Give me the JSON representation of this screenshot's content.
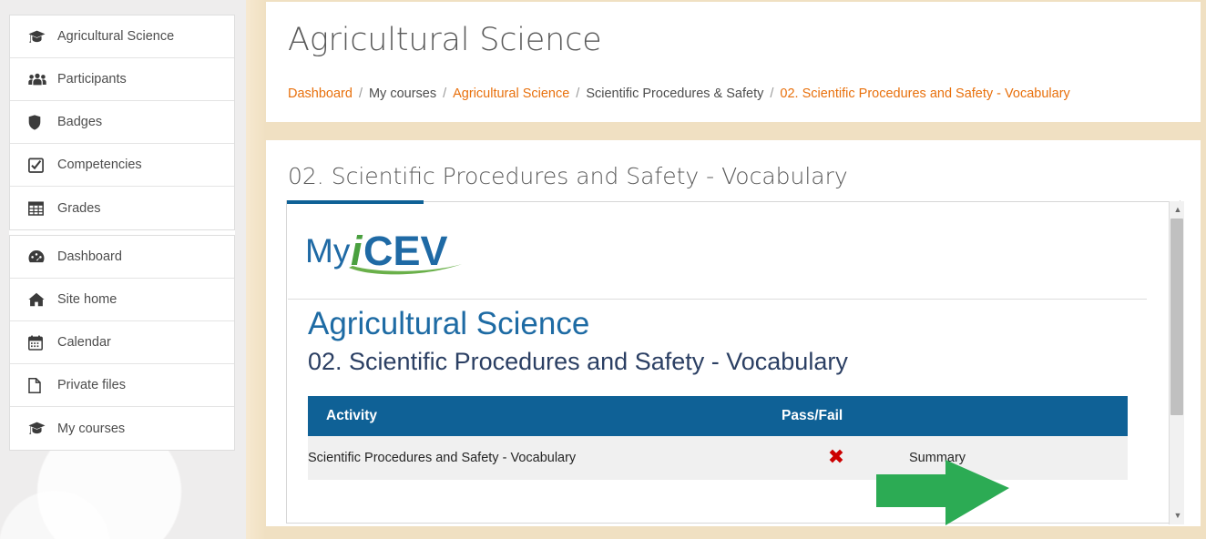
{
  "background": {
    "paper_color": "#f0e0c2",
    "accent_blue": "#0f6196",
    "breadcrumb_link": "#e8700c",
    "arrow_green": "#2cab54",
    "fail_red": "#cc0000"
  },
  "sidebar": {
    "groups": [
      {
        "items": [
          {
            "label": "Agricultural Science",
            "icon": "graduation-cap-icon"
          },
          {
            "label": "Participants",
            "icon": "users-icon"
          },
          {
            "label": "Badges",
            "icon": "shield-icon"
          },
          {
            "label": "Competencies",
            "icon": "check-square-icon"
          },
          {
            "label": "Grades",
            "icon": "table-icon"
          }
        ]
      },
      {
        "items": [
          {
            "label": "Dashboard",
            "icon": "tachometer-icon"
          },
          {
            "label": "Site home",
            "icon": "home-icon"
          },
          {
            "label": "Calendar",
            "icon": "calendar-icon"
          },
          {
            "label": "Private files",
            "icon": "file-icon"
          },
          {
            "label": "My courses",
            "icon": "graduation-cap-icon"
          }
        ]
      }
    ]
  },
  "header": {
    "title": "Agricultural Science",
    "breadcrumb": [
      {
        "label": "Dashboard",
        "link": true
      },
      {
        "label": "My courses",
        "link": false
      },
      {
        "label": "Agricultural Science",
        "link": true
      },
      {
        "label": "Scientific Procedures & Safety",
        "link": false
      },
      {
        "label": "02. Scientific Procedures and Safety - Vocabulary",
        "link": true
      }
    ],
    "separator": "/"
  },
  "main": {
    "activity_title": "02. Scientific Procedures and Safety - Vocabulary",
    "iframe": {
      "logo": {
        "my": "My",
        "i": "i",
        "cev": "CEV"
      },
      "heading": "Agricultural Science",
      "subheading": "02. Scientific Procedures and Safety - Vocabulary",
      "table": {
        "columns": [
          "Activity",
          "Pass/Fail"
        ],
        "rows": [
          {
            "activity": "Scientific Procedures and Safety - Vocabulary",
            "pass_fail": "✖",
            "pass_fail_state": "fail",
            "summary": "Summary"
          }
        ]
      }
    }
  },
  "annotation": {
    "type": "arrow",
    "direction": "right",
    "points_at": "Summary",
    "color": "#2cab54"
  },
  "scrollbar": {
    "up_arrow": "▲",
    "down_arrow": "▼",
    "orientation": "vertical"
  }
}
